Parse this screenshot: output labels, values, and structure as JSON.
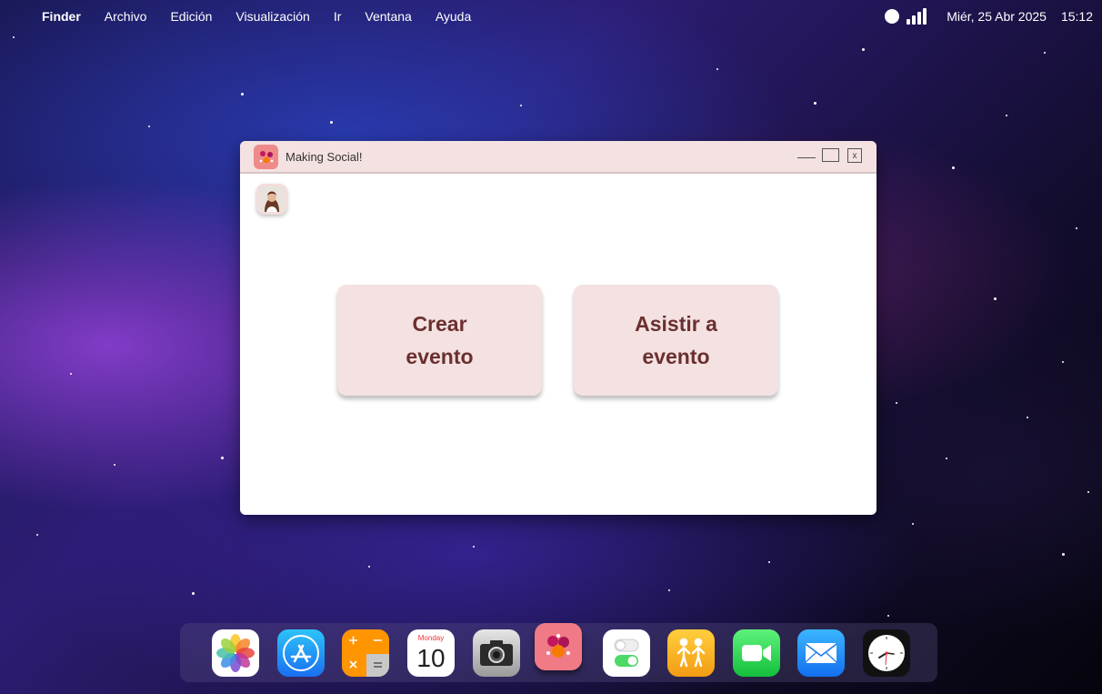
{
  "menubar": {
    "app_name": "Finder",
    "items": [
      "Archivo",
      "Edición",
      "Visualización",
      "Ir",
      "Ventana",
      "Ayuda"
    ],
    "date": "Miér, 25 Abr 2025",
    "time": "15:12"
  },
  "window": {
    "title": "Making Social!",
    "close_label": "x",
    "buttons": {
      "create": "Crear\nevento",
      "attend": "Asistir a\nevento"
    }
  },
  "dock": {
    "items": [
      "photos",
      "app-store",
      "calculator",
      "calendar",
      "camera",
      "making-social",
      "settings",
      "find-my",
      "facetime",
      "mail",
      "clock"
    ],
    "calendar_day": "Monday",
    "calendar_date": "10"
  },
  "colors": {
    "window_accent": "#f4e1e1",
    "button_text": "#6b2f2f",
    "app_icon": "#ef8a8a"
  }
}
